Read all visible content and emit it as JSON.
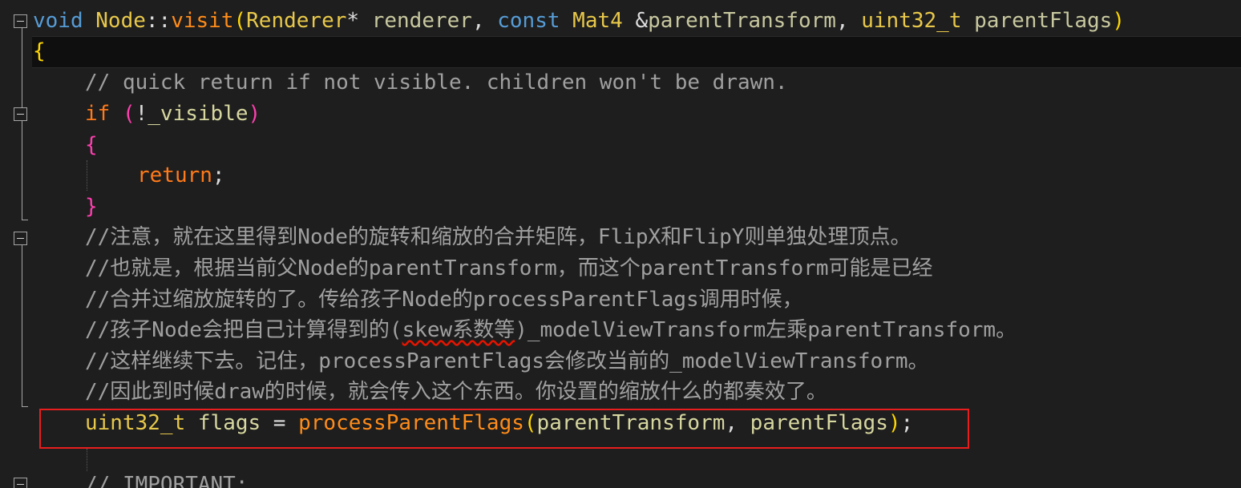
{
  "code": {
    "line1": {
      "void": "void",
      "node": "Node",
      "sep": "::",
      "visit": "visit",
      "open": "(",
      "renderer_type": "Renderer",
      "ptr": "*",
      "renderer": " renderer",
      "comma1": ", ",
      "const": "const",
      "mat4": " Mat4",
      "amp": " &",
      "parent_transform": "parentTransform",
      "comma2": ", ",
      "uint32": "uint32_t",
      "parent_flags": " parentFlags",
      "close": ")"
    },
    "line2": {
      "brace": "{"
    },
    "line3": {
      "comment": "// quick return if not visible. children won't be drawn."
    },
    "line4": {
      "if": "if",
      "space": " ",
      "open": "(",
      "not": "!",
      "visible": "_visible",
      "close": ")"
    },
    "line5": {
      "brace": "{"
    },
    "line6": {
      "return": "return",
      "semi": ";"
    },
    "line7": {
      "brace": "}"
    },
    "comments": [
      "//注意，就在这里得到Node的旋转和缩放的合并矩阵，FlipX和FlipY则单独处理顶点。",
      "//也就是，根据当前父Node的parentTransform，而这个parentTransform可能是已经",
      "//合并过缩放旋转的了。传给孩子Node的processParentFlags调用时候，"
    ],
    "line11": {
      "before": "//孩子Node会把自己计算得到的(",
      "squiggle": "skew系数等",
      "after": ")_modelViewTransform左乘parentTransform。"
    },
    "comments2": [
      "//这样继续下去。记住，processParentFlags会修改当前的_modelViewTransform。",
      "//因此到时候draw的时候，就会传入这个东西。你设置的缩放什么的都奏效了。"
    ],
    "line14": {
      "type": "uint32_t",
      "flags": " flags",
      "eq": " = ",
      "fn": "processParentFlags",
      "open": "(",
      "arg1": "parentTransform",
      "comma": ", ",
      "arg2": "parentFlags",
      "close": ")",
      "semi": ";"
    },
    "line16": {
      "comment": "// IMPORTANT:"
    }
  },
  "colors": {
    "keyword": "#569cd6",
    "type": "#e8c84a",
    "function": "#ff8c1a",
    "comment": "#a0a0a0",
    "highlight_box": "#e81e1e"
  }
}
